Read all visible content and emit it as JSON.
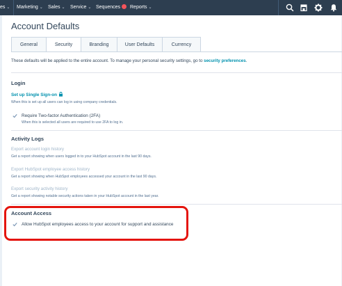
{
  "nav": {
    "items": [
      {
        "label": "es",
        "chevron": "⌄"
      },
      {
        "label": "Marketing",
        "chevron": "⌄"
      },
      {
        "label": "Sales",
        "chevron": "⌄"
      },
      {
        "label": "Service",
        "chevron": "⌄"
      },
      {
        "label": "Sequences",
        "chevron": ""
      },
      {
        "label": "Reports",
        "chevron": "⌄"
      }
    ],
    "icons": [
      "search-icon",
      "marketplace-icon",
      "settings-icon",
      "notifications-icon"
    ]
  },
  "page": {
    "title": "Account Defaults",
    "tabs": [
      "General",
      "Security",
      "Branding",
      "User Defaults",
      "Currency"
    ],
    "active_tab": "Security"
  },
  "intro": {
    "text": "These defaults will be applied to the entire account. To manage your personal security settings, go to ",
    "link": "security preferences",
    "suffix": "."
  },
  "login": {
    "heading": "Login",
    "sso_link": "Set up Single Sign-on",
    "sso_help": "When this is set up all users can log in using company credentials.",
    "twofa_label": "Require Two-factor Authentication (2FA)",
    "twofa_help": "When this is selected all users are required to use 2FA to log in."
  },
  "activity": {
    "heading": "Activity Logs",
    "items": [
      {
        "label": "Export account login history",
        "help": "Get a report showing when users logged in to your HubSpot account in the last 90 days."
      },
      {
        "label": "Export HubSpot employee access history",
        "help": "Get a report showing when HubSpot employees accessed your account in the last 90 days."
      },
      {
        "label": "Export security activity history",
        "help": "Get a report showing notable security actions taken in your HubSpot account in the last year."
      }
    ]
  },
  "access": {
    "heading": "Account Access",
    "label": "Allow HubSpot employees access to your account for support and assistance"
  },
  "colors": {
    "nav_bg": "#2d3e50",
    "link": "#0091ae",
    "disabled_link": "#9fb5c9",
    "highlight": "#e4140d"
  }
}
